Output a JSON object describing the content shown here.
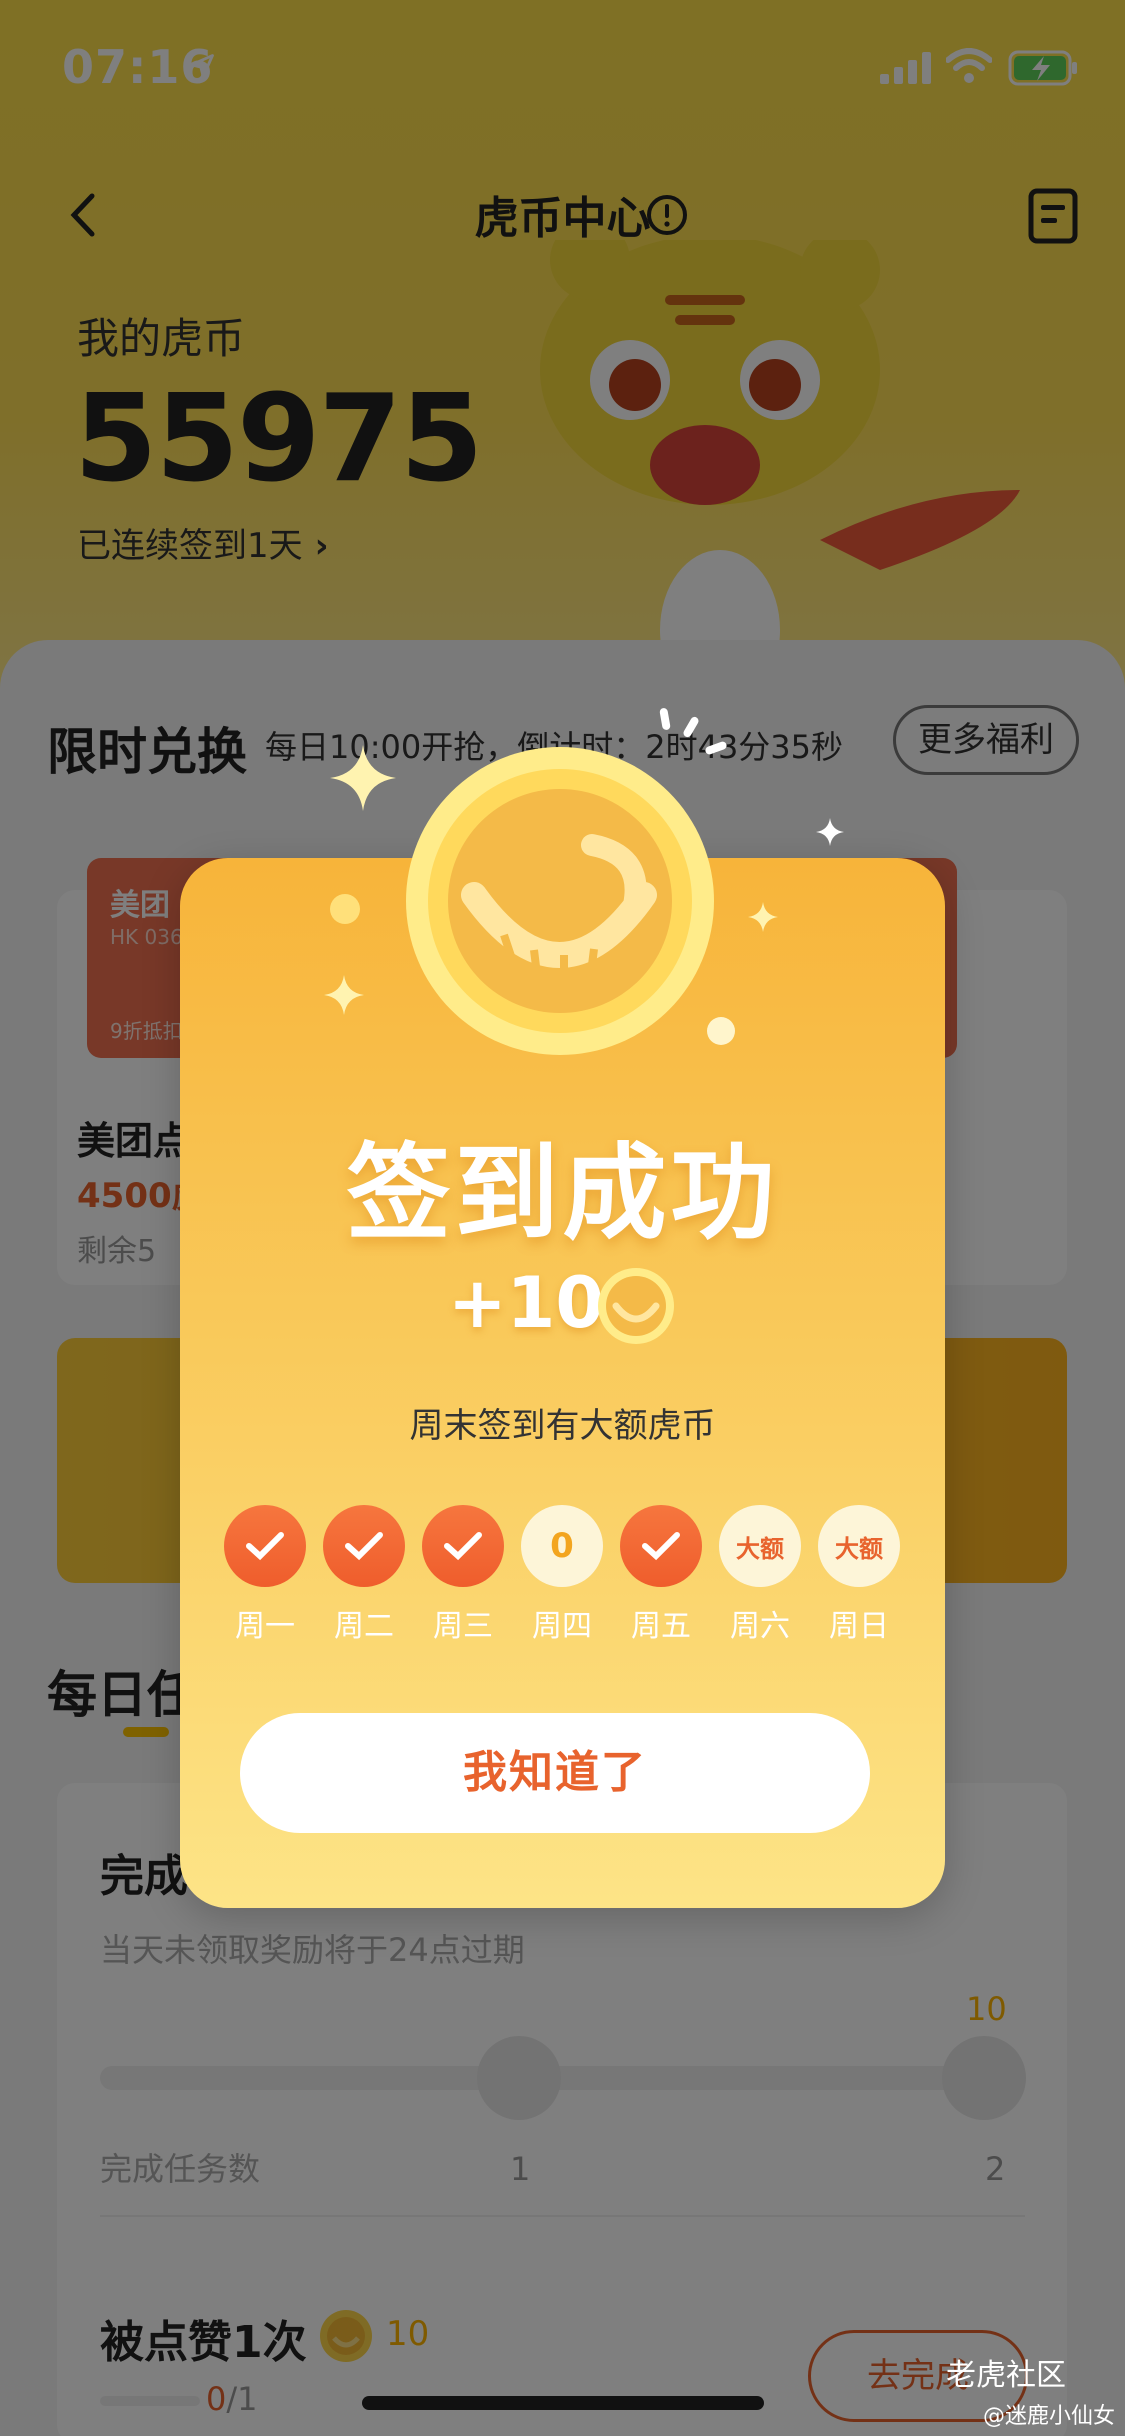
{
  "status_bar": {
    "time": "07:16"
  },
  "header": {
    "title": "虎币中心"
  },
  "wallet": {
    "label": "我的虎币",
    "balance": "55975",
    "streak_link": "已连续签到1天"
  },
  "flash_sale": {
    "title": "限时兑换",
    "subtitle": "每日10:00开抢，倒计时：2时43分35秒",
    "more_button": "更多福利",
    "coupon": {
      "name": "美团",
      "code": "HK 036",
      "discount": "9折抵扣"
    },
    "product": {
      "name": "美团点",
      "price": "4500虎",
      "remain": "剩余5"
    }
  },
  "daily_tasks": {
    "title": "每日任",
    "task1": {
      "title": "完成",
      "note": "当天未领取奖励将于24点过期",
      "max_reward": "10",
      "count_label": "完成任务数",
      "milestones": [
        "1",
        "2"
      ]
    },
    "task2": {
      "title": "被点赞1次",
      "reward": "10",
      "progress_done": "0",
      "progress_total": "/1",
      "button": "去完成"
    }
  },
  "modal": {
    "title": "签到成功",
    "reward": "+10",
    "subtitle": "周末签到有大额虎币",
    "days": [
      {
        "label": "周一",
        "state": "done",
        "text": ""
      },
      {
        "label": "周二",
        "state": "done",
        "text": ""
      },
      {
        "label": "周三",
        "state": "done",
        "text": ""
      },
      {
        "label": "周四",
        "state": "todo",
        "text": "0"
      },
      {
        "label": "周五",
        "state": "done",
        "text": ""
      },
      {
        "label": "周六",
        "state": "bonus",
        "text": "大额"
      },
      {
        "label": "周日",
        "state": "bonus",
        "text": "大额"
      }
    ],
    "confirm_button": "我知道了"
  },
  "watermark": {
    "site": "老虎社区",
    "user": "@迷鹿小仙女"
  },
  "colors": {
    "accent": "#e8632d",
    "brand_yellow": "#ffd83a",
    "coin": "#ffb400"
  }
}
